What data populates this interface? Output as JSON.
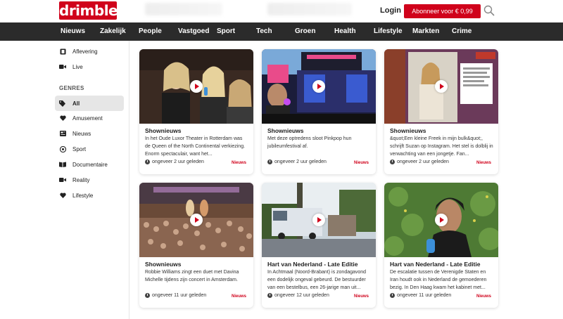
{
  "brand": {
    "logo_text": "drimble",
    "accent": "#d0021b"
  },
  "header": {
    "login_label": "Login",
    "subscribe_label": "Abonneer voor € 0,99 /week"
  },
  "nav": {
    "items": [
      "Nieuws",
      "Zakelijk",
      "People",
      "Vastgoed",
      "Sport",
      "Tech",
      "Groen",
      "Health",
      "Lifestyle",
      "Markten",
      "Crime"
    ]
  },
  "sidebar": {
    "top_items": [
      {
        "label": "Aflevering",
        "icon": "film-icon"
      },
      {
        "label": "Live",
        "icon": "video-camera-icon"
      }
    ],
    "genres_title": "GENRES",
    "genres": [
      {
        "label": "All",
        "icon": "tags-icon",
        "active": true
      },
      {
        "label": "Amusement",
        "icon": "heart-icon"
      },
      {
        "label": "Nieuws",
        "icon": "newspaper-icon"
      },
      {
        "label": "Sport",
        "icon": "soccer-ball-icon"
      },
      {
        "label": "Documentaire",
        "icon": "book-icon"
      },
      {
        "label": "Reality",
        "icon": "video-camera-icon"
      },
      {
        "label": "Lifestyle",
        "icon": "heart-icon"
      }
    ]
  },
  "cards": [
    {
      "title": "Shownieuws",
      "desc": "In het Oude Luxor Theater in Rotterdam was de Queen of the North Continental verkiezing. Enorm spectaculair, want het...",
      "time": "ongeveer 2 uur geleden",
      "category": "Nieuws"
    },
    {
      "title": "Shownieuws",
      "desc": "Met deze optredens sloot Pinkpop hun jubileumfestival af.",
      "time": "ongeveer 2 uur geleden",
      "category": "Nieuws"
    },
    {
      "title": "Shownieuws",
      "desc": "&quot;Een kleine Freek in mijn bulk&quot;, schrijft Suzan op Instagram. Het stel is dolblij in verwachting van een jongetje. Fan...",
      "time": "ongeveer 2 uur geleden",
      "category": "Nieuws"
    },
    {
      "title": "Shownieuws",
      "desc": "Robbie Williams zingt een duet met Davina Michelle tijdens zijn concert in Amsterdam.",
      "time": "ongeveer 11 uur geleden",
      "category": "Nieuws"
    },
    {
      "title": "Hart van Nederland - Late Editie",
      "desc": "In Achtmaal (Noord-Brabant) is zondagavond een dodelijk ongeval gebeurd. De bestuurder van een bestelbus, een 26-jarige man uit...",
      "time": "ongeveer 12 uur geleden",
      "category": "Nieuws"
    },
    {
      "title": "Hart van Nederland - Late Editie",
      "desc": "De escalatie tussen de Verenigde Staten en Iran houdt ook in Nederland de gemoederen bezig. In Den Haag kwam het kabinet met...",
      "time": "ongeveer 11 uur geleden",
      "category": "Nieuws"
    }
  ]
}
